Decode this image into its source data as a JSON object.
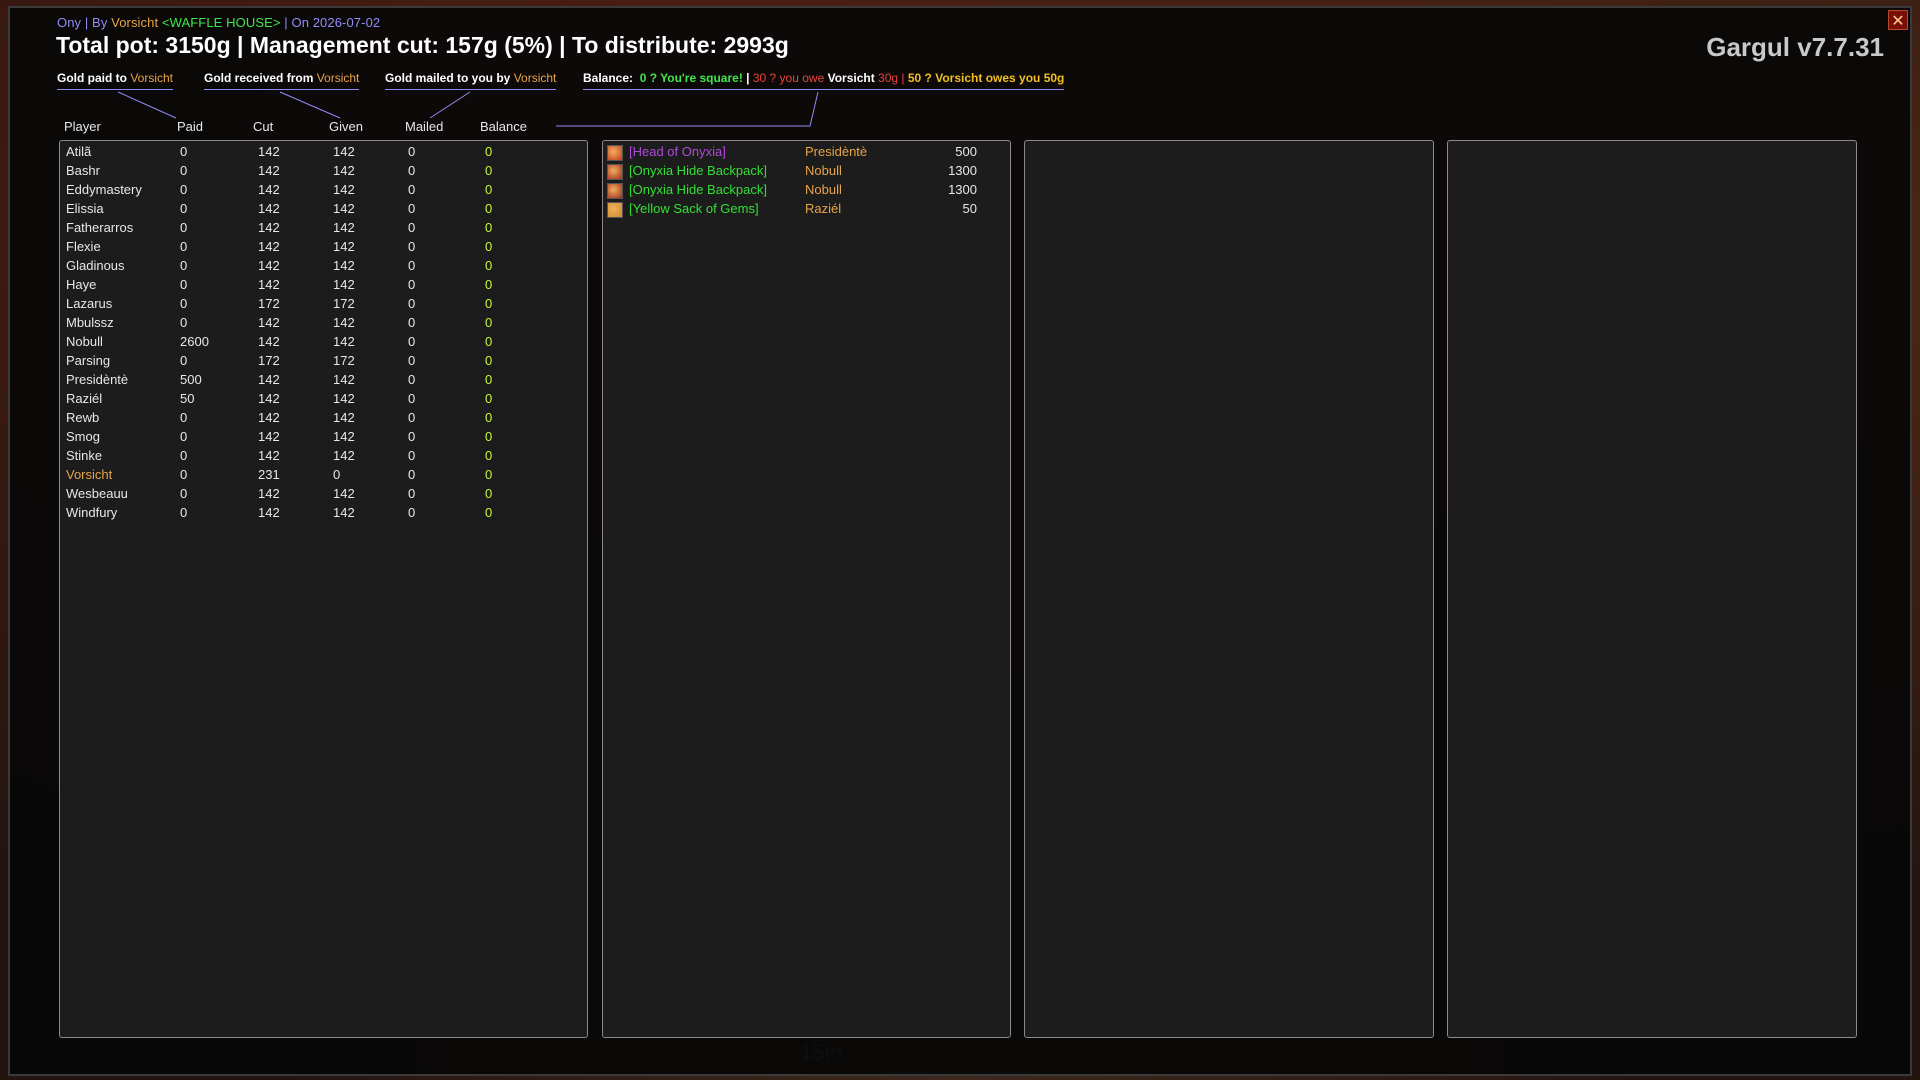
{
  "header": {
    "sub": {
      "raid": "Ony",
      "sep1": " | By ",
      "leader": "Vorsicht",
      "guild": " <WAFFLE HOUSE>",
      "sep2": " | On 2026-07-02"
    },
    "title": "Total pot: 3150g | Management cut: 157g (5%) | To distribute: 2993g",
    "version": "Gargul v7.7.31"
  },
  "legend": {
    "paid_label": "Gold paid to ",
    "received_label": "Gold received from ",
    "mailed_label": "Gold mailed to you by ",
    "name": "Vorsicht",
    "balance_label": "Balance:",
    "square": "0 ? You're square!",
    "pipe": "|",
    "owe_pre": "30 ? you owe ",
    "owe_name": "Vorsicht",
    "owe_amt": " 30g",
    "owes_pre": "50 ? ",
    "owes_name": "Vorsicht",
    "owes_post": " owes you 50g"
  },
  "columns": [
    "Player",
    "Paid",
    "Cut",
    "Given",
    "Mailed",
    "Balance"
  ],
  "players": [
    {
      "name": "Atilã",
      "paid": "0",
      "cut": "142",
      "given": "142",
      "mailed": "0",
      "balance": "0"
    },
    {
      "name": "Bashr",
      "paid": "0",
      "cut": "142",
      "given": "142",
      "mailed": "0",
      "balance": "0"
    },
    {
      "name": "Eddymastery",
      "paid": "0",
      "cut": "142",
      "given": "142",
      "mailed": "0",
      "balance": "0"
    },
    {
      "name": "Elissia",
      "paid": "0",
      "cut": "142",
      "given": "142",
      "mailed": "0",
      "balance": "0"
    },
    {
      "name": "Fatherarros",
      "paid": "0",
      "cut": "142",
      "given": "142",
      "mailed": "0",
      "balance": "0"
    },
    {
      "name": "Flexie",
      "paid": "0",
      "cut": "142",
      "given": "142",
      "mailed": "0",
      "balance": "0"
    },
    {
      "name": "Gladinous",
      "paid": "0",
      "cut": "142",
      "given": "142",
      "mailed": "0",
      "balance": "0"
    },
    {
      "name": "Haye",
      "paid": "0",
      "cut": "142",
      "given": "142",
      "mailed": "0",
      "balance": "0"
    },
    {
      "name": "Lazarus",
      "paid": "0",
      "cut": "172",
      "given": "172",
      "mailed": "0",
      "balance": "0"
    },
    {
      "name": "Mbulssz",
      "paid": "0",
      "cut": "142",
      "given": "142",
      "mailed": "0",
      "balance": "0"
    },
    {
      "name": "Nobull",
      "paid": "2600",
      "cut": "142",
      "given": "142",
      "mailed": "0",
      "balance": "0"
    },
    {
      "name": "Parsing",
      "paid": "0",
      "cut": "172",
      "given": "172",
      "mailed": "0",
      "balance": "0"
    },
    {
      "name": "Presidèntè",
      "paid": "500",
      "cut": "142",
      "given": "142",
      "mailed": "0",
      "balance": "0"
    },
    {
      "name": "Raziél",
      "paid": "50",
      "cut": "142",
      "given": "142",
      "mailed": "0",
      "balance": "0"
    },
    {
      "name": "Rewb",
      "paid": "0",
      "cut": "142",
      "given": "142",
      "mailed": "0",
      "balance": "0"
    },
    {
      "name": "Smog",
      "paid": "0",
      "cut": "142",
      "given": "142",
      "mailed": "0",
      "balance": "0"
    },
    {
      "name": "Stinke",
      "paid": "0",
      "cut": "142",
      "given": "142",
      "mailed": "0",
      "balance": "0"
    },
    {
      "name": "Vorsicht",
      "paid": "0",
      "cut": "231",
      "given": "0",
      "mailed": "0",
      "balance": "0",
      "highlight": true
    },
    {
      "name": "Wesbeauu",
      "paid": "0",
      "cut": "142",
      "given": "142",
      "mailed": "0",
      "balance": "0"
    },
    {
      "name": "Windfury",
      "paid": "0",
      "cut": "142",
      "given": "142",
      "mailed": "0",
      "balance": "0"
    }
  ],
  "loot": [
    {
      "item": "[Head of Onyxia]",
      "quality": "epic",
      "winner": "Presidèntè",
      "price": "500",
      "icon": "onyxia-head-icon"
    },
    {
      "item": "[Onyxia Hide Backpack]",
      "quality": "uncommon",
      "winner": "Nobull",
      "price": "1300",
      "icon": "backpack-icon"
    },
    {
      "item": "[Onyxia Hide Backpack]",
      "quality": "uncommon",
      "winner": "Nobull",
      "price": "1300",
      "icon": "backpack-icon"
    },
    {
      "item": "[Yellow Sack of Gems]",
      "quality": "uncommon",
      "winner": "Raziél",
      "price": "50",
      "icon": "gem-sack-icon"
    }
  ],
  "colors": {
    "epic": "#b04ad8",
    "uncommon": "#32e034",
    "winner": "#e8a44a",
    "balance": "#c8f83e",
    "highlight": "#e8a44a",
    "accent": "#8f8cf6"
  },
  "hud": {
    "timer": "15m"
  }
}
